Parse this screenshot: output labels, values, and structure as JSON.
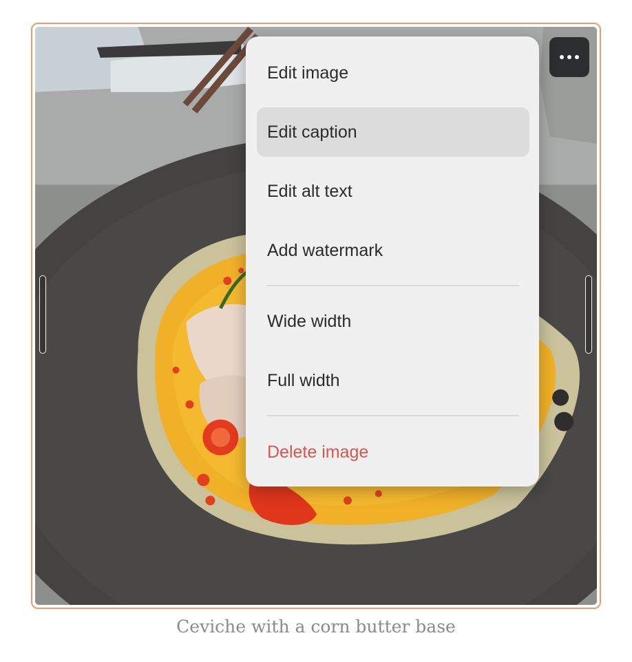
{
  "image": {
    "icon": "photo"
  },
  "more_button": {
    "icon": "more-horizontal-icon"
  },
  "menu": {
    "items": [
      {
        "label": "Edit image"
      },
      {
        "label": "Edit caption"
      },
      {
        "label": "Edit alt text"
      },
      {
        "label": "Add watermark"
      },
      {
        "label": "Wide width"
      },
      {
        "label": "Full width"
      },
      {
        "label": "Delete image"
      }
    ]
  },
  "caption": "Ceviche with a corn butter base",
  "colors": {
    "selection_outline": "#f39a6b",
    "danger": "#d9554f",
    "menu_background": "#f0f0f0",
    "hover_background": "#dcdcdc"
  }
}
